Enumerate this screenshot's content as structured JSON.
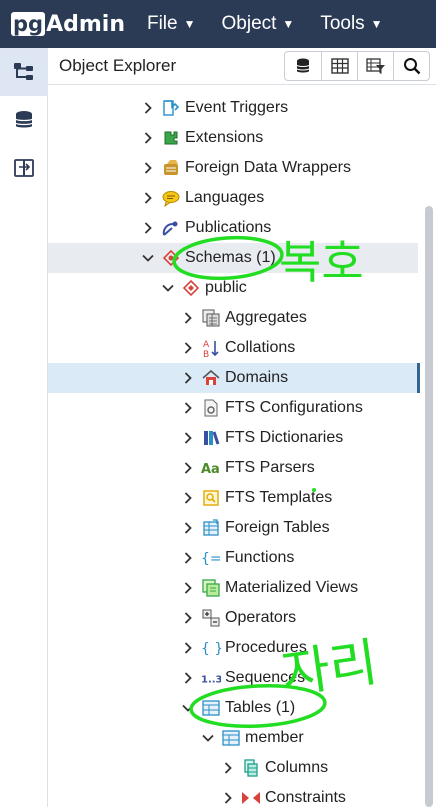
{
  "app": {
    "logo_pg": "pg",
    "logo_admin": "Admin"
  },
  "menu": [
    {
      "label": "File"
    },
    {
      "label": "Object"
    },
    {
      "label": "Tools"
    }
  ],
  "panel": {
    "title": "Object Explorer"
  },
  "tree": [
    {
      "label": "Event Triggers",
      "icon": "event-trigger-icon",
      "expanded": false
    },
    {
      "label": "Extensions",
      "icon": "extension-icon",
      "expanded": false
    },
    {
      "label": "Foreign Data Wrappers",
      "icon": "fdw-icon",
      "expanded": false
    },
    {
      "label": "Languages",
      "icon": "language-icon",
      "expanded": false
    },
    {
      "label": "Publications",
      "icon": "publication-icon",
      "expanded": false
    },
    {
      "label": "Schemas (1)",
      "icon": "schema-icon",
      "expanded": true,
      "highlighted": true
    },
    {
      "label": "public",
      "icon": "schema-public-icon",
      "expanded": true
    },
    {
      "label": "Aggregates",
      "icon": "aggregate-icon",
      "expanded": false
    },
    {
      "label": "Collations",
      "icon": "collation-icon",
      "expanded": false
    },
    {
      "label": "Domains",
      "icon": "domain-icon",
      "expanded": false,
      "selected": true
    },
    {
      "label": "FTS Configurations",
      "icon": "fts-config-icon",
      "expanded": false
    },
    {
      "label": "FTS Dictionaries",
      "icon": "fts-dictionary-icon",
      "expanded": false
    },
    {
      "label": "FTS Parsers",
      "icon": "fts-parser-icon",
      "expanded": false
    },
    {
      "label": "FTS Templates",
      "icon": "fts-template-icon",
      "expanded": false
    },
    {
      "label": "Foreign Tables",
      "icon": "foreign-table-icon",
      "expanded": false
    },
    {
      "label": "Functions",
      "icon": "function-icon",
      "expanded": false
    },
    {
      "label": "Materialized Views",
      "icon": "matview-icon",
      "expanded": false
    },
    {
      "label": "Operators",
      "icon": "operator-icon",
      "expanded": false
    },
    {
      "label": "Procedures",
      "icon": "procedure-icon",
      "expanded": false
    },
    {
      "label": "Sequences",
      "icon": "sequence-icon",
      "expanded": false
    },
    {
      "label": "Tables (1)",
      "icon": "table-icon",
      "expanded": true
    },
    {
      "label": "member",
      "icon": "table-icon",
      "expanded": true
    },
    {
      "label": "Columns",
      "icon": "column-icon",
      "expanded": false
    },
    {
      "label": "Constraints",
      "icon": "constraint-icon",
      "expanded": false
    }
  ],
  "annotations": {
    "text_1": "복호",
    "text_2": "자리"
  },
  "colors": {
    "topbar": "#2b3a55",
    "selected": "#dbeaf7",
    "annotation": "#22dd22"
  }
}
